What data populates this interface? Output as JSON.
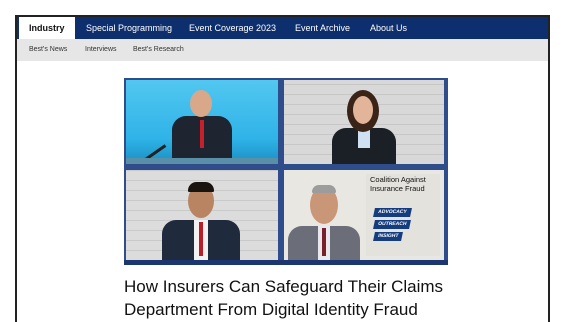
{
  "nav": {
    "primary": [
      {
        "label": "Industry",
        "active": true
      },
      {
        "label": "Special Programming",
        "active": false
      },
      {
        "label": "Event Coverage 2023",
        "active": false
      },
      {
        "label": "Event Archive",
        "active": false
      },
      {
        "label": "About Us",
        "active": false
      }
    ],
    "secondary": [
      {
        "label": "Best's News"
      },
      {
        "label": "Interviews"
      },
      {
        "label": "Best's Research"
      }
    ]
  },
  "video": {
    "logo_text": "Coalition Against Insurance Fraud",
    "logo_tags": [
      "ADVOCACY",
      "OUTREACH",
      "INSIGHT"
    ]
  },
  "article": {
    "headline_line1": "How Insurers Can Safeguard Their Claims",
    "headline_line2": "Department From Digital Identity Fraud"
  },
  "colors": {
    "nav_bg": "#0e2f6e",
    "subnav_bg": "#e6e6e6",
    "video_frame": "#2e4d8a"
  }
}
